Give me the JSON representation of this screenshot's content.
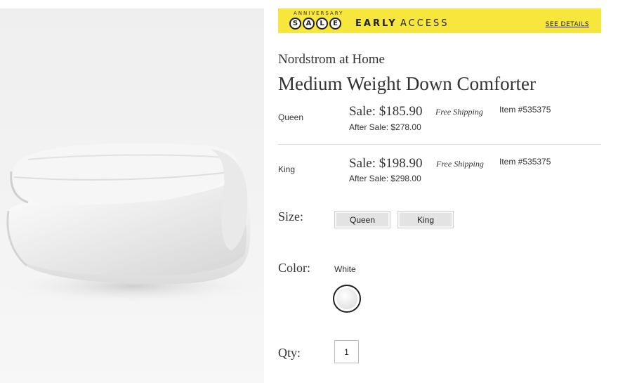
{
  "banner": {
    "anniversary": "ANNIVERSARY",
    "sale_letters": [
      "S",
      "A",
      "L",
      "E"
    ],
    "early": "EARLY",
    "access": "ACCESS",
    "see_details": "SEE DETAILS",
    "color": "#f7e63c"
  },
  "product": {
    "brand": "Nordstrom at Home",
    "title": "Medium Weight Down Comforter",
    "image_icon": "comforter-photo"
  },
  "variants": [
    {
      "size": "Queen",
      "sale_price": "Sale: $185.90",
      "shipping": "Free Shipping",
      "item_no": "Item #535375",
      "after_sale": "After Sale: $278.00"
    },
    {
      "size": "King",
      "sale_price": "Sale: $198.90",
      "shipping": "Free Shipping",
      "item_no": "Item #535375",
      "after_sale": "After Sale: $298.00"
    }
  ],
  "size_selector": {
    "label": "Size:",
    "options": [
      "Queen",
      "King"
    ]
  },
  "color_selector": {
    "label": "Color:",
    "value": "White",
    "swatch_icon": "white-swatch-icon"
  },
  "quantity": {
    "label": "Qty:",
    "value": "1"
  }
}
